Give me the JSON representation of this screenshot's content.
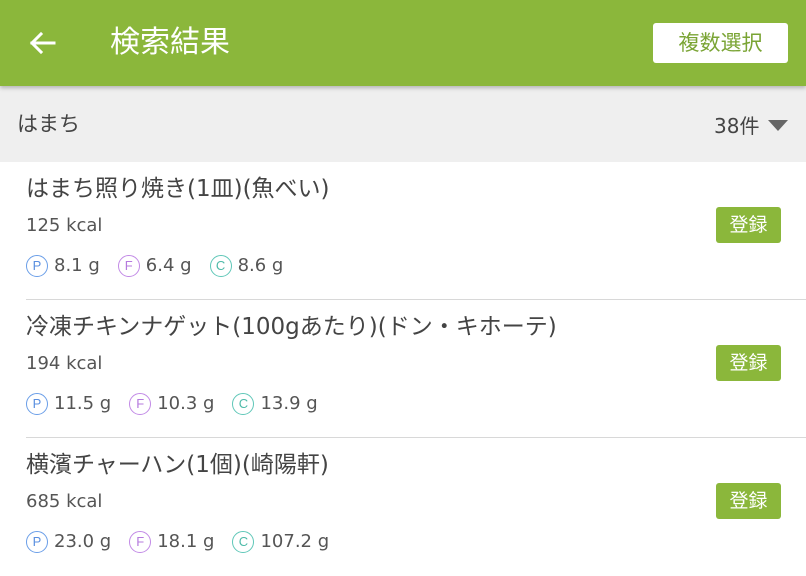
{
  "appbar": {
    "title": "検索結果",
    "multi_select_label": "複数選択",
    "back_icon": "arrow-left-icon",
    "bg_color": "#8bb73b"
  },
  "search": {
    "query": "はまち",
    "count": "38件",
    "sort_icon": "caret-down-icon"
  },
  "results": [
    {
      "name": "はまち照り焼き(1皿)(魚べい)",
      "kcal": "125 kcal",
      "protein": "8.1 g",
      "fat": "6.4 g",
      "carbs": "8.6 g",
      "register_label": "登録"
    },
    {
      "name": "冷凍チキンナゲット(100gあたり)(ドン・キホーテ)",
      "kcal": "194 kcal",
      "protein": "11.5 g",
      "fat": "10.3 g",
      "carbs": "13.9 g",
      "register_label": "登録"
    },
    {
      "name": "横濱チャーハン(1個)(崎陽軒)",
      "kcal": "685 kcal",
      "protein": "23.0 g",
      "fat": "18.1 g",
      "carbs": "107.2 g",
      "register_label": "登録"
    }
  ],
  "macro_badges": {
    "p": "P",
    "f": "F",
    "c": "C"
  }
}
